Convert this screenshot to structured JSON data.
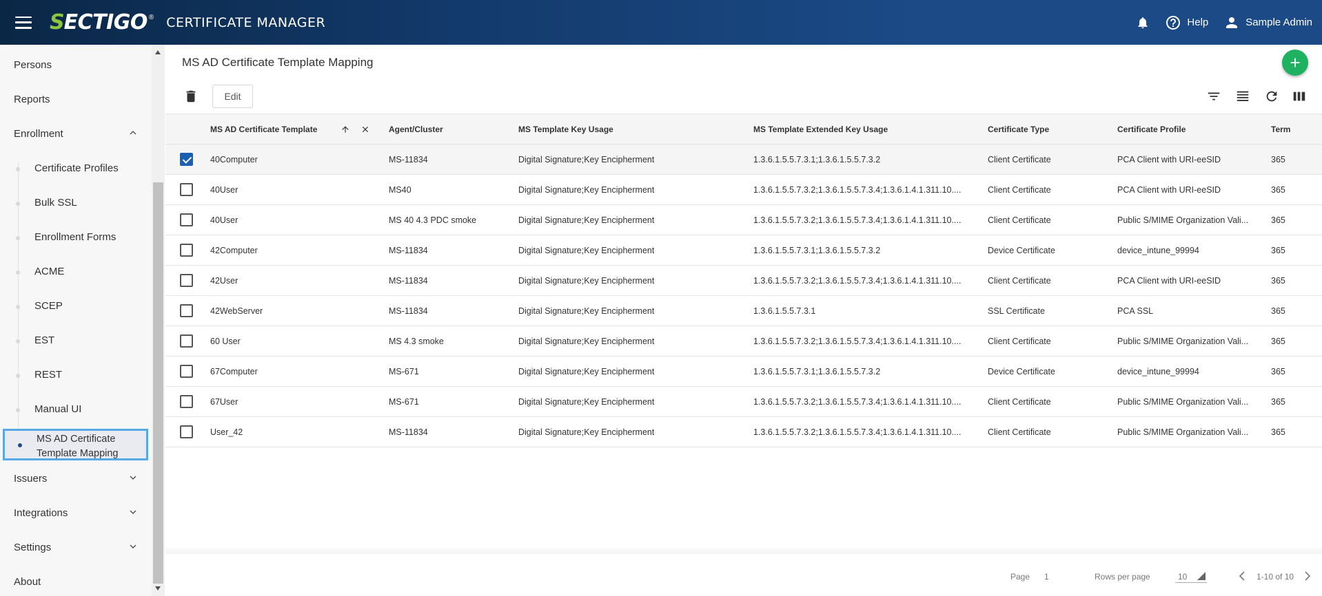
{
  "header": {
    "logo_s": "S",
    "logo_rest": "ECTIGO",
    "logo_reg": "®",
    "app_title": "CERTIFICATE MANAGER",
    "help_label": "Help",
    "user_label": "Sample Admin"
  },
  "sidebar": {
    "top_items": [
      {
        "label": "Persons"
      },
      {
        "label": "Reports"
      },
      {
        "label": "Enrollment"
      }
    ],
    "enrollment_children": [
      {
        "label": "Certificate Profiles"
      },
      {
        "label": "Bulk SSL"
      },
      {
        "label": "Enrollment Forms"
      },
      {
        "label": "ACME"
      },
      {
        "label": "SCEP"
      },
      {
        "label": "EST"
      },
      {
        "label": "REST"
      },
      {
        "label": "Manual UI"
      }
    ],
    "active_item": {
      "line1": "MS AD Certificate",
      "line2": "Template Mapping"
    },
    "bottom_items": [
      {
        "label": "Issuers"
      },
      {
        "label": "Integrations"
      },
      {
        "label": "Settings"
      },
      {
        "label": "About"
      }
    ]
  },
  "main": {
    "title": "MS AD Certificate Template Mapping",
    "edit_label": "Edit"
  },
  "table": {
    "columns": [
      "MS AD Certificate Template",
      "Agent/Cluster",
      "MS Template Key Usage",
      "MS Template Extended Key Usage",
      "Certificate Type",
      "Certificate Profile",
      "Term"
    ],
    "rows": [
      {
        "selected": true,
        "cells": [
          "40Computer",
          "MS-11834",
          "Digital Signature;Key Encipherment",
          "1.3.6.1.5.5.7.3.1;1.3.6.1.5.5.7.3.2",
          "Client Certificate",
          "PCA Client with URI-eeSID",
          "365"
        ]
      },
      {
        "selected": false,
        "cells": [
          "40User",
          "MS40",
          "Digital Signature;Key Encipherment",
          "1.3.6.1.5.5.7.3.2;1.3.6.1.5.5.7.3.4;1.3.6.1.4.1.311.10....",
          "Client Certificate",
          "PCA Client with URI-eeSID",
          "365"
        ]
      },
      {
        "selected": false,
        "cells": [
          "40User",
          "MS 40 4.3 PDC smoke",
          "Digital Signature;Key Encipherment",
          "1.3.6.1.5.5.7.3.2;1.3.6.1.5.5.7.3.4;1.3.6.1.4.1.311.10....",
          "Client Certificate",
          "Public S/MIME Organization Vali...",
          "365"
        ]
      },
      {
        "selected": false,
        "cells": [
          "42Computer",
          "MS-11834",
          "Digital Signature;Key Encipherment",
          "1.3.6.1.5.5.7.3.1;1.3.6.1.5.5.7.3.2",
          "Device Certificate",
          "device_intune_99994",
          "365"
        ]
      },
      {
        "selected": false,
        "cells": [
          "42User",
          "MS-11834",
          "Digital Signature;Key Encipherment",
          "1.3.6.1.5.5.7.3.2;1.3.6.1.5.5.7.3.4;1.3.6.1.4.1.311.10....",
          "Client Certificate",
          "PCA Client with URI-eeSID",
          "365"
        ]
      },
      {
        "selected": false,
        "cells": [
          "42WebServer",
          "MS-11834",
          "Digital Signature;Key Encipherment",
          "1.3.6.1.5.5.7.3.1",
          "SSL Certificate",
          "PCA SSL",
          "365"
        ]
      },
      {
        "selected": false,
        "cells": [
          "60 User",
          "MS 4.3 smoke",
          "Digital Signature;Key Encipherment",
          "1.3.6.1.5.5.7.3.2;1.3.6.1.5.5.7.3.4;1.3.6.1.4.1.311.10....",
          "Client Certificate",
          "Public S/MIME Organization Vali...",
          "365"
        ]
      },
      {
        "selected": false,
        "cells": [
          "67Computer",
          "MS-671",
          "Digital Signature;Key Encipherment",
          "1.3.6.1.5.5.7.3.1;1.3.6.1.5.5.7.3.2",
          "Device Certificate",
          "device_intune_99994",
          "365"
        ]
      },
      {
        "selected": false,
        "cells": [
          "67User",
          "MS-671",
          "Digital Signature;Key Encipherment",
          "1.3.6.1.5.5.7.3.2;1.3.6.1.5.5.7.3.4;1.3.6.1.4.1.311.10....",
          "Client Certificate",
          "Public S/MIME Organization Vali...",
          "365"
        ]
      },
      {
        "selected": false,
        "cells": [
          "User_42",
          "MS-11834",
          "Digital Signature;Key Encipherment",
          "1.3.6.1.5.5.7.3.2;1.3.6.1.5.5.7.3.4;1.3.6.1.4.1.311.10....",
          "Client Certificate",
          "Public S/MIME Organization Vali...",
          "365"
        ]
      }
    ]
  },
  "footer": {
    "page_label": "Page",
    "page_value": "1",
    "rows_label": "Rows per page",
    "rows_value": "10",
    "range": "1-10 of 10"
  },
  "colors": {
    "header_bg": "#1b4a86",
    "logo_green": "#8cc63f",
    "fab_green": "#1fb162",
    "checkbox_blue": "#1a5fb4",
    "active_outline": "#56a8e6"
  },
  "icons": {
    "menu": "hamburger-icon",
    "notifications": "bell-icon",
    "help": "help-circle-icon",
    "user": "person-icon",
    "add": "plus-icon",
    "delete": "trash-icon",
    "filter": "filter-icon",
    "density": "density-icon",
    "refresh": "refresh-icon",
    "columns": "columns-icon",
    "sort": "arrow-up-icon",
    "clear_sort": "close-icon"
  }
}
